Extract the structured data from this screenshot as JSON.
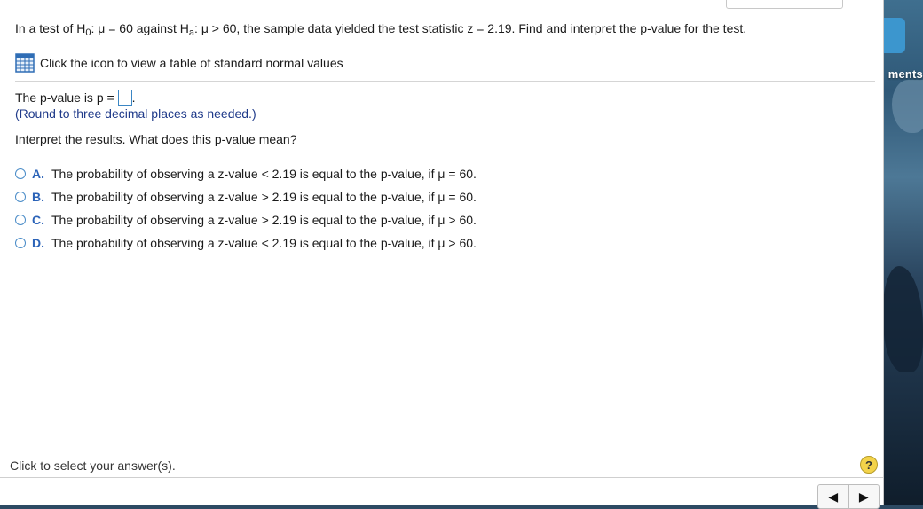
{
  "question": {
    "p1": "In a test of H",
    "sub0": "0",
    "p2": ": μ = 60 against H",
    "suba": "a",
    "p3": ": μ > 60, the sample data yielded the test statistic z = 2.19. Find and interpret the p-value for the test."
  },
  "table_link": {
    "label": "Click the icon to view a table of standard normal values",
    "icon": "table-icon"
  },
  "pvalue": {
    "label": "The p-value is p =",
    "value": "",
    "suffix": ".",
    "note": "(Round to three decimal places as needed.)"
  },
  "interpret_prompt": "Interpret the results. What does this p-value mean?",
  "options": [
    {
      "letter": "A.",
      "text": "The probability of observing a z-value < 2.19 is equal to the p-value, if μ = 60."
    },
    {
      "letter": "B.",
      "text": "The probability of observing a z-value > 2.19 is equal to the p-value, if μ = 60."
    },
    {
      "letter": "C.",
      "text": "The probability of observing a z-value > 2.19 is equal to the p-value, if μ > 60."
    },
    {
      "letter": "D.",
      "text": "The probability of observing a z-value < 2.19 is equal to the p-value, if μ > 60."
    }
  ],
  "status": "Click to select your answer(s).",
  "help_label": "?",
  "nav": {
    "prev": "◀",
    "next": "▶"
  },
  "desktop_label": "ments",
  "colors": {
    "accent": "#2b63b8",
    "input_border": "#3b86c4",
    "help": "#f3d34a"
  }
}
